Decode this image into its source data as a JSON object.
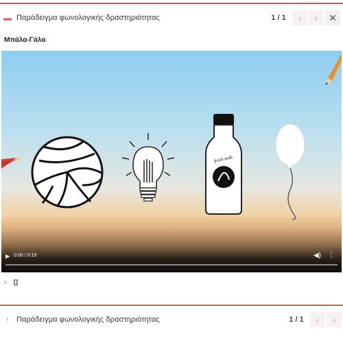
{
  "header_top": {
    "title": "Παράδειγμα φωνολογικής δραστηριότητας",
    "counter": "1 / 1",
    "prev_icon": "chevron-left",
    "next_icon": "chevron-right",
    "close_icon": "close"
  },
  "activity": {
    "label": "Μπάλα-Γάλα"
  },
  "video": {
    "time": "0:00 / 0:19",
    "milk_label": "fresh milk",
    "play_icon": "play",
    "volume_icon": "volume",
    "more_icon": "more-vertical"
  },
  "below_video": {
    "chevron": "›",
    "icon_text": "[]"
  },
  "header_bottom": {
    "title": "Παράδειγμα φωνολογικής δραστηριότητας",
    "counter": "1 / 1",
    "prev_icon": "chevron-left",
    "next_icon": "chevron-right",
    "close_icon": "close"
  },
  "colors": {
    "accent": "#c85a5a",
    "sky_top": "#8ecdf0",
    "horizon": "#f1d2a6",
    "pencil": "#e8902a"
  }
}
